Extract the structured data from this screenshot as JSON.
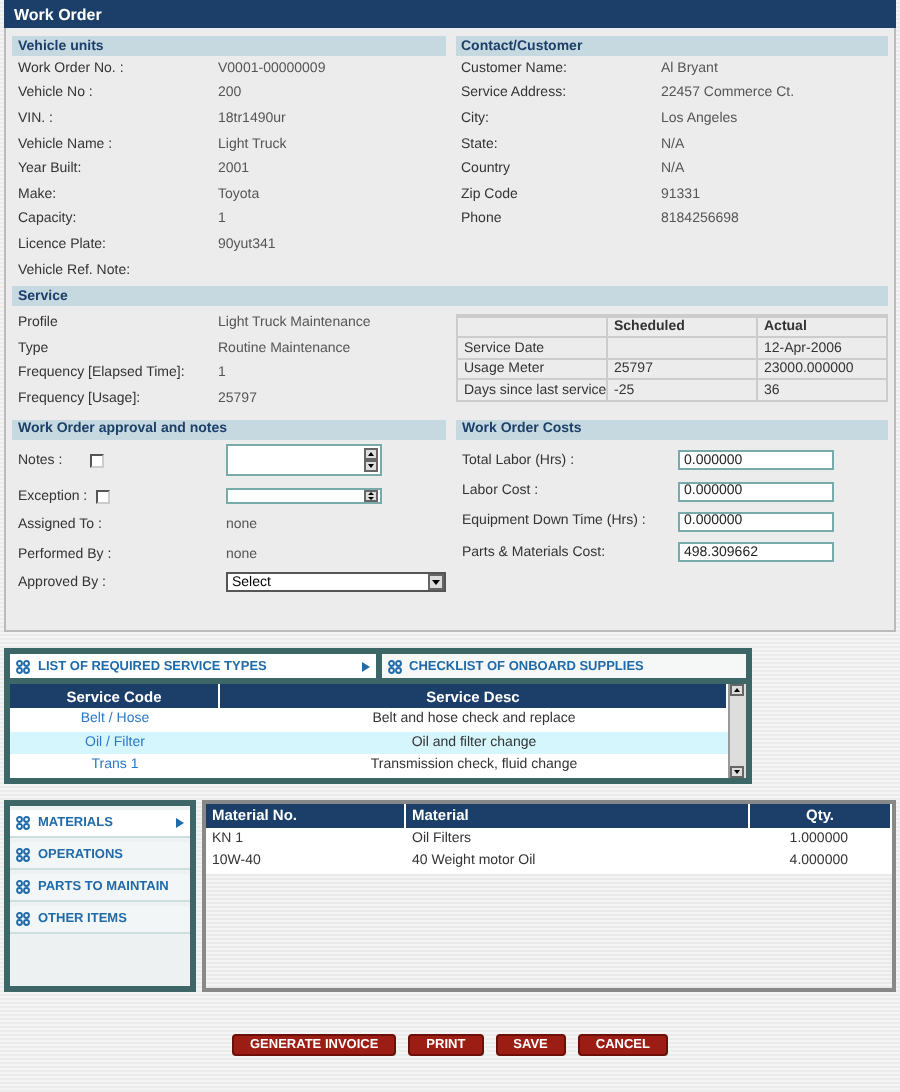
{
  "window": {
    "title": "Work Order"
  },
  "vehicle_units": {
    "title": "Vehicle units",
    "fields": [
      {
        "label": "Work Order No. :",
        "value": "V0001-00000009"
      },
      {
        "label": "Vehicle No :",
        "value": "200"
      },
      {
        "label": "VIN. :",
        "value": "18tr1490ur"
      },
      {
        "label": "Vehicle Name :",
        "value": "Light Truck"
      },
      {
        "label": "Year Built:",
        "value": "2001"
      },
      {
        "label": "Make:",
        "value": "Toyota"
      },
      {
        "label": "Capacity:",
        "value": "1"
      },
      {
        "label": "Licence Plate:",
        "value": "90yut341"
      },
      {
        "label": "Vehicle Ref. Note:"
      }
    ]
  },
  "contact": {
    "title": "Contact/Customer",
    "fields": [
      {
        "label": "Customer Name:",
        "value": "Al Bryant"
      },
      {
        "label": "Service Address:",
        "value": "22457 Commerce Ct."
      },
      {
        "label": "City:",
        "value": "Los Angeles"
      },
      {
        "label": "State:",
        "value": "N/A"
      },
      {
        "label": "Country",
        "value": "N/A"
      },
      {
        "label": "Zip Code",
        "value": "91331"
      },
      {
        "label": "Phone",
        "value": "8184256698"
      }
    ]
  },
  "service": {
    "title": "Service",
    "fields": [
      {
        "label": "Profile",
        "value": "Light Truck Maintenance"
      },
      {
        "label": "Type",
        "value": "Routine Maintenance"
      },
      {
        "label": "Frequency [Elapsed Time]:",
        "value": "1"
      },
      {
        "label": "Frequency [Usage]:",
        "value": "25797"
      }
    ],
    "schedule_table": {
      "columns": [
        "Scheduled",
        "Actual"
      ],
      "rows": [
        {
          "label": "Service Date",
          "actual": "12-Apr-2006"
        },
        {
          "label": "Usage Meter",
          "scheduled": "25797",
          "actual": "23000.000000"
        },
        {
          "label": "Days since last service",
          "scheduled": "-25",
          "actual": "36"
        }
      ]
    }
  },
  "approval": {
    "title": "Work Order approval and notes",
    "fields": [
      {
        "kind": "checkarea",
        "label": "Notes :",
        "checked": false
      },
      {
        "kind": "checkinput",
        "label": "Exception :",
        "checked": false
      },
      {
        "kind": "text",
        "label": "Assigned To :",
        "value": "none"
      },
      {
        "kind": "text",
        "label": "Performed By :",
        "value": "none"
      },
      {
        "kind": "select",
        "label": "Approved By :",
        "value": "Select"
      }
    ]
  },
  "costs": {
    "title": "Work Order Costs",
    "fields": [
      {
        "label": "Total Labor (Hrs) :",
        "value": "0.000000"
      },
      {
        "label": "Labor Cost :",
        "value": "0.000000"
      },
      {
        "label": "Equipment Down Time (Hrs) :",
        "value": "0.000000"
      },
      {
        "label": "Parts & Materials Cost:",
        "value": "498.309662"
      }
    ]
  },
  "service_tabs": [
    {
      "label": "LIST OF REQUIRED SERVICE TYPES",
      "selected": true
    },
    {
      "label": "CHECKLIST OF ONBOARD SUPPLIES",
      "selected": false
    }
  ],
  "service_table": {
    "columns": [
      "Service Code",
      "Service Desc"
    ],
    "rows": [
      {
        "code": "Belt / Hose",
        "desc": "Belt and hose check and replace",
        "selected": false
      },
      {
        "code": "Oil / Filter",
        "desc": "Oil and filter change",
        "selected": true
      },
      {
        "code": "Trans 1",
        "desc": "Transmission check, fluid change",
        "selected": false
      }
    ]
  },
  "side_tabs": [
    {
      "label": "MATERIALS",
      "selected": true
    },
    {
      "label": "OPERATIONS",
      "selected": false
    },
    {
      "label": "PARTS TO MAINTAIN",
      "selected": false
    },
    {
      "label": "OTHER ITEMS",
      "selected": false
    }
  ],
  "materials_table": {
    "columns": [
      "Material No.",
      "Material",
      "Qty."
    ],
    "rows": [
      [
        "KN 1",
        "Oil Filters",
        "1.000000"
      ],
      [
        "10W-40",
        "40 Weight motor Oil",
        "4.000000"
      ]
    ]
  },
  "buttons": [
    "GENERATE INVOICE",
    "PRINT",
    "SAVE",
    "CANCEL"
  ]
}
